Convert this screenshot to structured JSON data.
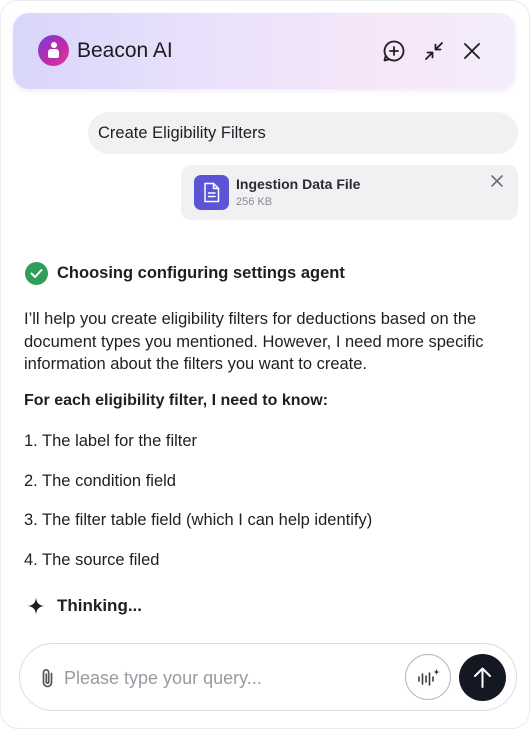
{
  "header": {
    "title": "Beacon AI",
    "icons": [
      "beacon-logo-icon",
      "new-chat-icon",
      "collapse-icon",
      "close-icon"
    ]
  },
  "conversation": {
    "user_message": "Create Eligibility Filters",
    "attachment": {
      "name": "Ingestion Data File",
      "size": "256 KB",
      "icon": "document-icon"
    },
    "agent_status": "Choosing configuring settings agent",
    "response_intro": "I’ll help you create eligibility filters for deductions based on the document types you mentioned. However, I need more specific information about the filters you want to create.",
    "need_heading": "For each eligibility filter, I need to know:",
    "items": [
      "1. The label for the filter",
      "2. The condition field",
      "3. The filter table field (which I can help identify)",
      "4. The source filed"
    ],
    "thinking": "Thinking..."
  },
  "composer": {
    "placeholder": "Please type your query...",
    "value": ""
  },
  "colors": {
    "accent": "#5b55d6",
    "success": "#2f9e5b",
    "send_button": "#141823"
  }
}
